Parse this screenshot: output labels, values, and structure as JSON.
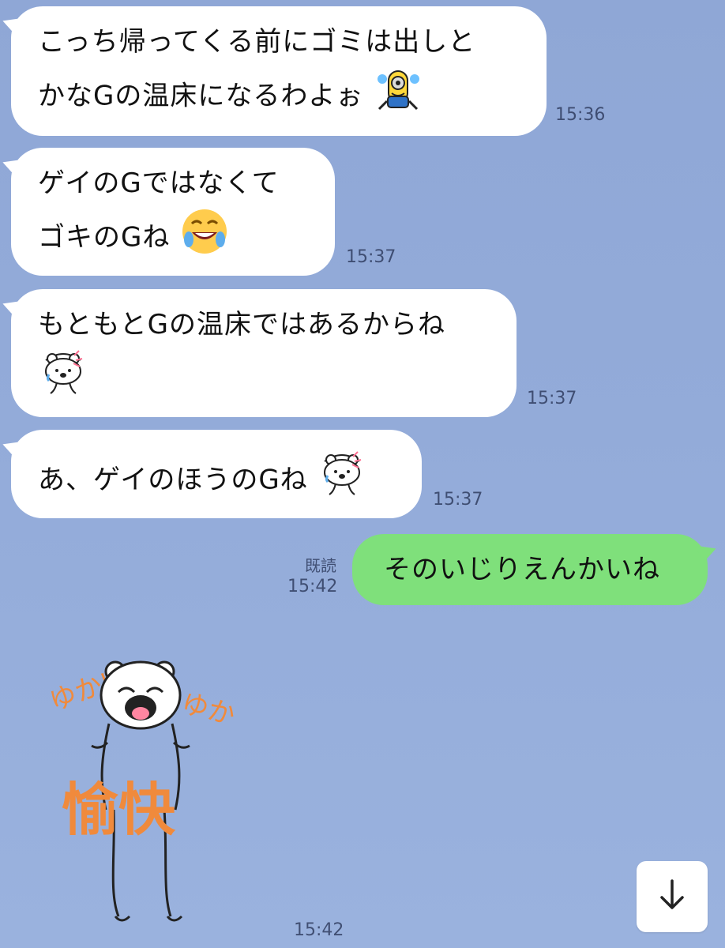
{
  "chat": {
    "messages": [
      {
        "from": "incoming",
        "lines": [
          "こっち帰ってくる前にゴミは出しと",
          "かなGの温床になるわよぉ"
        ],
        "time": "15:36",
        "sticker_emoji": "minion-cry-icon"
      },
      {
        "from": "incoming",
        "lines": [
          "ゲイのGではなくて",
          "ゴキのGね"
        ],
        "time": "15:37",
        "sticker_emoji": "laughing-crying-emoji-icon"
      },
      {
        "from": "incoming",
        "lines": [
          "もともとGの温床ではあるからね"
        ],
        "time": "15:37",
        "sticker_emoji": "bear-sweat-icon"
      },
      {
        "from": "incoming",
        "lines": [
          "あ、ゲイのほうのGね"
        ],
        "time": "15:37",
        "sticker_emoji": "bear-sweat-icon"
      },
      {
        "from": "outgoing",
        "lines": [
          "そのいじりえんかいね"
        ],
        "time": "15:42",
        "status": "既読"
      }
    ],
    "sticker_message": {
      "time": "15:42",
      "sticker_text": {
        "left": "ゆかい",
        "right": "ゆかい",
        "main": "愉快"
      },
      "icon": "bear-laughing-sticker"
    }
  },
  "ui": {
    "scroll_button_icon": "arrow-down-icon"
  },
  "colors": {
    "incoming_bubble": "#ffffff",
    "outgoing_bubble": "#7fe07b",
    "background": "#93abd9",
    "sticker_text": "#f08a3c"
  }
}
